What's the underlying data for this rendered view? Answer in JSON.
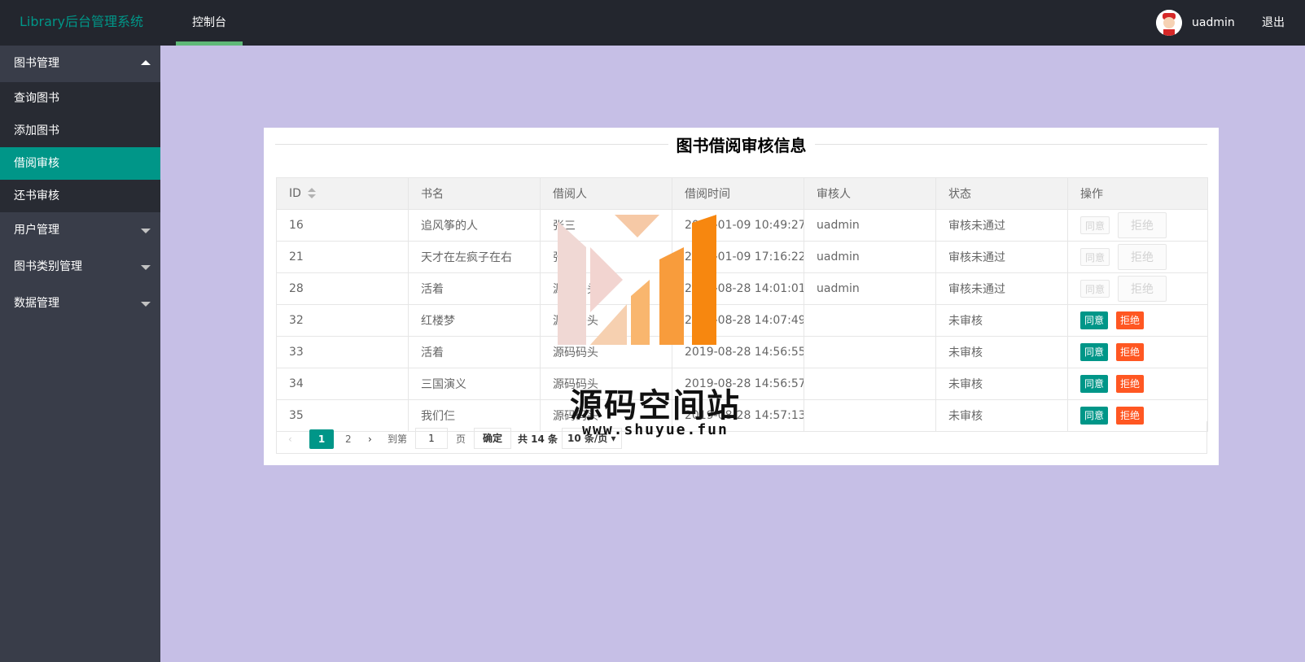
{
  "header": {
    "logo": "Library后台管理系统",
    "nav": "控制台",
    "username": "uadmin",
    "logout": "退出"
  },
  "sidebar": {
    "groups": [
      {
        "label": "图书管理",
        "expanded": true,
        "items": [
          "查询图书",
          "添加图书",
          "借阅审核",
          "还书审核"
        ],
        "active": "借阅审核"
      },
      {
        "label": "用户管理",
        "expanded": false
      },
      {
        "label": "图书类别管理",
        "expanded": false
      },
      {
        "label": "数据管理",
        "expanded": false
      }
    ]
  },
  "card": {
    "title": "图书借阅审核信息"
  },
  "table": {
    "headers": [
      "ID",
      "书名",
      "借阅人",
      "借阅时间",
      "审核人",
      "状态",
      "操作"
    ],
    "rows": [
      [
        "16",
        "追风筝的人",
        "张三",
        "2019-01-09 10:49:27",
        "uadmin",
        "审核未通过"
      ],
      [
        "21",
        "天才在左疯子在右",
        "张三",
        "2019-01-09 17:16:22",
        "uadmin",
        "审核未通过"
      ],
      [
        "28",
        "活着",
        "源码码头",
        "2019-08-28 14:01:01",
        "uadmin",
        "审核未通过"
      ],
      [
        "32",
        "红楼梦",
        "源码码头",
        "2019-08-28 14:07:49",
        "",
        "未审核"
      ],
      [
        "33",
        "活着",
        "源码码头",
        "2019-08-28 14:56:55",
        "",
        "未审核"
      ],
      [
        "34",
        "三国演义",
        "源码码头",
        "2019-08-28 14:56:57",
        "",
        "未审核"
      ],
      [
        "35",
        "我们仨",
        "源码码头",
        "2019-08-28 14:57:13",
        "",
        "未审核"
      ]
    ],
    "approve_label": "同意",
    "reject_label": "拒绝"
  },
  "pager": {
    "prev": "‹",
    "current": "1",
    "page2": "2",
    "next": "›",
    "goto": "到第",
    "input_value": "1",
    "page_unit": "页",
    "confirm": "确定",
    "total": "共 14 条",
    "limit": "10 条/页"
  },
  "watermark": {
    "cn": "源码空间站",
    "url": "www.shuyue.fun"
  },
  "colors": {
    "header_bg": "#23262e",
    "sidebar_bg": "#393d49",
    "active": "#009688",
    "reject": "#ff5722",
    "page_bg": "#c6bfe6"
  }
}
